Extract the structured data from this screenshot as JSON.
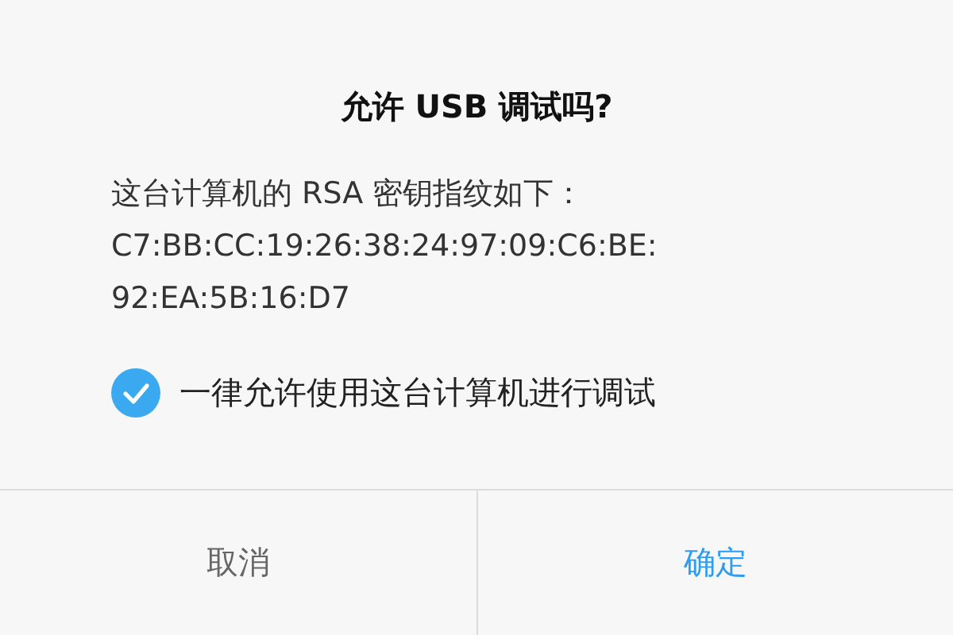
{
  "dialog": {
    "title": "允许 USB 调试吗?",
    "message_lines": [
      "这台计算机的 RSA 密钥指纹如下：",
      "C7:BB:CC:19:26:38:24:97:09:C6:BE:",
      "92:EA:5B:16:D7"
    ],
    "checkbox": {
      "label": "一律允许使用这台计算机进行调试",
      "checked": true
    },
    "buttons": [
      {
        "label": "取消",
        "kind": "cancel"
      },
      {
        "label": "确定",
        "kind": "confirm"
      }
    ]
  }
}
